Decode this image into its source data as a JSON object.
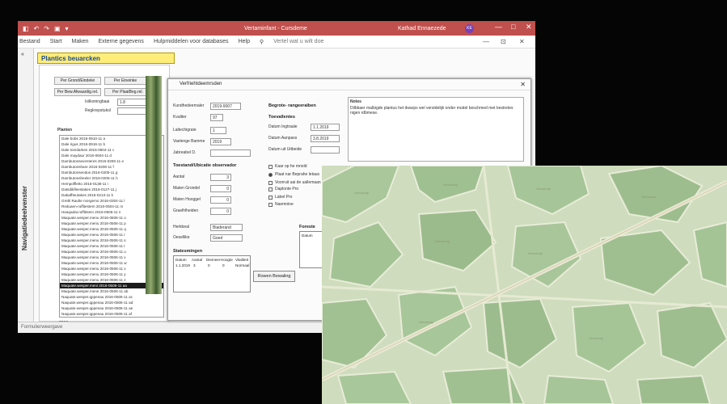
{
  "titlebar": {
    "qat": [
      "◧",
      "↶",
      "↷",
      "▣",
      "▾"
    ],
    "title": "Vertaminfant - Cursdeme",
    "user": "Kathad Ennaezede",
    "avatar": "KE",
    "window_buttons": [
      "—",
      "□",
      "✕"
    ]
  },
  "ribbon": {
    "tabs": [
      "Bestand",
      "Start",
      "Maken",
      "Externe gegevens",
      "Hulpmiddelen voor databases",
      "Help"
    ],
    "tell_me": "Vertel wat u wilt doe",
    "right_buttons": [
      "—",
      "⊡",
      "✕"
    ]
  },
  "navpane": {
    "toggle": "«",
    "label": "Navigatiedeelvenster"
  },
  "statusbar": {
    "text": "Formulierweergave"
  },
  "form": {
    "header": "Plantics beuarcken",
    "buttons": [
      "Per Grond/Eindelei",
      "Per Eineinke",
      "Per Bew.Afwaardig.rel.",
      "Per PlaatBeg.rel."
    ],
    "filter_label": "Ixilkoningbaai",
    "filter_value": "1.8",
    "count_label": "Regkrepstukol",
    "count_value": "",
    "list_header": "Planten",
    "list_rows": [
      "Dale bobs          2016-0910-11  a",
      "Dale rigus         2016-0916-11  b",
      "Dale tomdarkes     2016-0504-11  c",
      "Dale maydaur       2016-0604-11  d",
      "Dambutonseventeres 2016-0206-11  e",
      "Dambutonshare      2016-0206-11  f",
      "Dambutonsendus     2016-0205-11  g",
      "Dambutonsheeler    2016-0205-11  h",
      "Hempoffletto       2016-0138-11  i",
      "Datsdikfleestakes  2016-0127-11  j",
      "Dabaffteutakes     2016-0213-11  k",
      "Grebl Raulte morgemo 2016-0304-11 l",
      "Reduaen-ruffitestem 2016-0504-11 m",
      "Heaqadat.ruffitstem 2016-0506-11 n",
      "Maquate.wesper.menu 2016-0506-11 o",
      "Maquate.wesper.menu 2016-0506-11 p",
      "Maquate.wesper.menu 2016-0506-11 q",
      "Maquate.wesper.menu 2016-0506-11 r",
      "Maquate.wesper.menu 2016-0506-11 s",
      "Maquate.wesper.menu 2016-0506-11 t",
      "Maquate.wesper.menu 2016-0506-11 u",
      "Maquate.wesper.menu 2016-0506-11 v",
      "Maquate.wesper.menu 2016-0506-11 w",
      "Maquate.wesper.menu 2016-0506-11 x",
      "Maquate.wesper.menu 2016-0506-11 y",
      "Maquate.wesper.menu 2016-0506-11 z",
      "Maquate.wesper.meni 2016-0506-11 aa",
      "Maquate.wesper.mene 2016-0506-11 ab",
      "Naquate.wesper.qppenau 2016-0506-11 ac",
      "Naquate.wesper.qppenau 2016-0506-11 ad",
      "Naquate.wesper.qppenau 2016-0506-11 ae",
      "Naquate.wesper.qppenau 2016-0506-11 af"
    ],
    "selected_row_index": 26,
    "footer": "2019"
  },
  "dialog": {
    "title": "Verfriehtdeemrsden",
    "close": "✕",
    "fields_left": [
      {
        "label": "Kundhedeernaler",
        "value": "2019-9007"
      },
      {
        "label": "Kvaliter",
        "value": "97"
      },
      {
        "label": "Laltechigrate",
        "value": "1"
      },
      {
        "label": "Vaelenge Bamme",
        "value": "2019"
      },
      {
        "label": "Jabreabel D.",
        "value": ""
      }
    ],
    "group_right_title": "Begrote- rangeeraiben",
    "group_right_sub": "Toevallentes",
    "fields_right": [
      {
        "label": "Datum Ingtraale",
        "value": "1.1.2019"
      },
      {
        "label": "Datum Aanpass",
        "value": "3.8.2019"
      },
      {
        "label": "Datum uit Uitbeide",
        "value": ""
      }
    ],
    "group2_title": "Toestand/Ubicatie observador",
    "fields_group2": [
      {
        "label": "Aantal",
        "value": "3"
      },
      {
        "label": "Maten Grondel",
        "value": "0"
      },
      {
        "label": "Maten Hooggel",
        "value": "0"
      },
      {
        "label": "Graelhlheiden",
        "value": "0"
      }
    ],
    "options": [
      "Kaar op he mnold",
      "Plaat nar Beprahe letaus",
      "Voorruit uai de uallemaan",
      "Daplonte   Pro",
      "Label      Pro",
      "Naemnine"
    ],
    "selects": [
      {
        "label": "Herkbeal",
        "value": "Bladerand"
      },
      {
        "label": "Oesellike",
        "value": "Goed"
      }
    ],
    "table_title": "Statesmingen",
    "table_headers": [
      "Datum",
      "Aantal",
      "Diemeer",
      "Hoogte",
      "Vitaliteit"
    ],
    "table_row": [
      "1.1.2019",
      "3",
      "0",
      "0",
      "Normaal"
    ],
    "table2_title": "Foreste",
    "table2_header": "Datum",
    "notes_title": "Notes",
    "notes_text": "Dilbbaer malbigde plantus het dwarps wel verstdelijk onder model beschmed met bestretes nigen rdbmese.",
    "print_button": "Rowen Bewaling"
  },
  "map": {
    "labels": [
      "Vervoerdy",
      "Vervoerdy",
      "Vervoerdy",
      "Vervoerdy",
      "Vervoerdy",
      "Vervoerdy",
      "Vervoerdy",
      "Vervoerdy"
    ]
  },
  "colors": {
    "titlebar": "#c0504d",
    "form_header": "#ffed7a",
    "map_bg": "#cfdcbd",
    "map_parcel": "#a7c49a",
    "map_road": "#e3e8cf"
  }
}
